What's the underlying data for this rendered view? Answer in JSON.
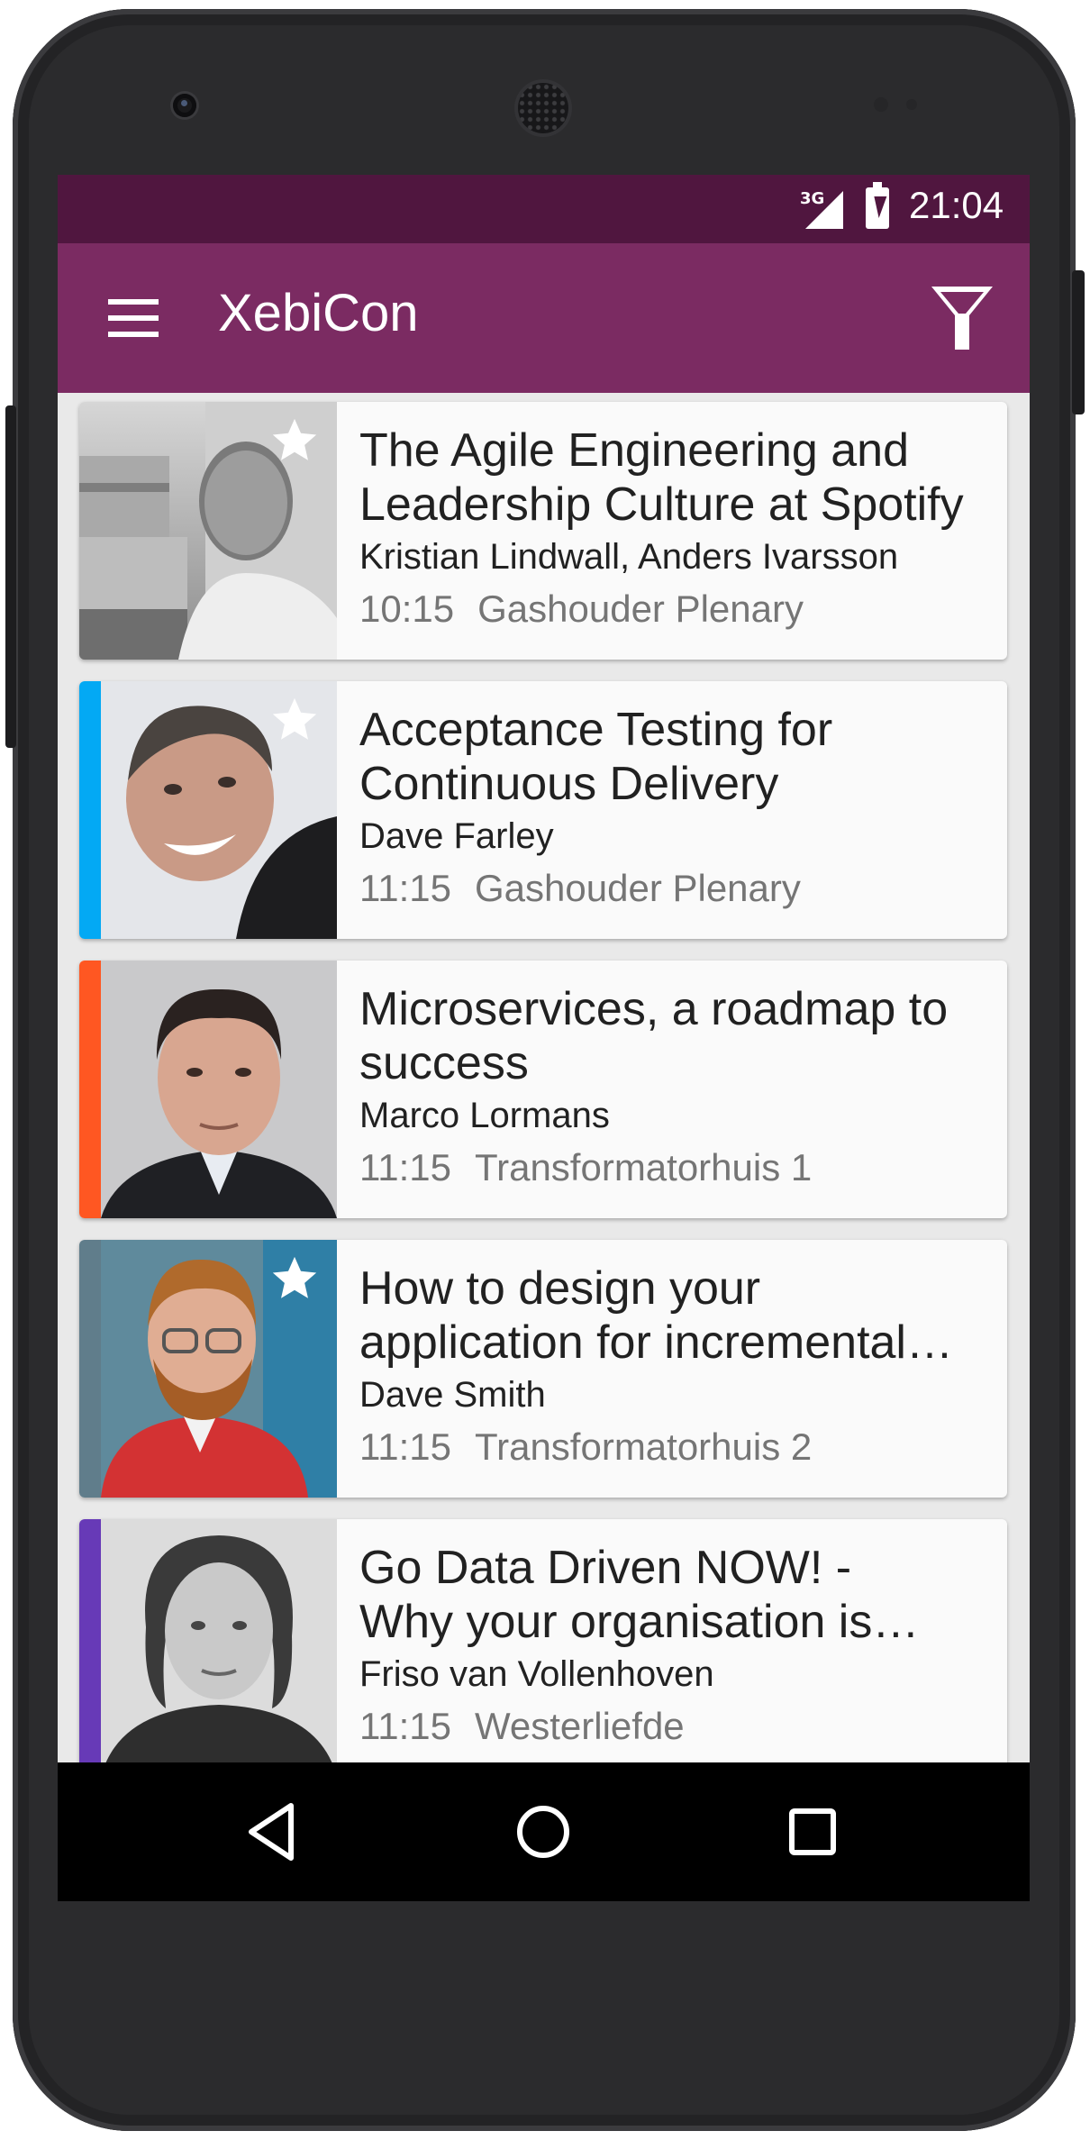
{
  "status_bar": {
    "network": "3G",
    "time": "21:04"
  },
  "app_bar": {
    "title": "XebiCon",
    "menu_icon": "hamburger-menu-icon",
    "filter_icon": "filter-funnel-icon"
  },
  "sessions": [
    {
      "title_lines": [
        "The Agile Engineering and",
        "Leadership Culture at Spotify"
      ],
      "speakers": "Kristian Lindwall, Anders Ivarsson",
      "time": "10:15",
      "location": "Gashouder Plenary",
      "favorite": true,
      "accent_color": "#9e9e9e"
    },
    {
      "title_lines": [
        "Acceptance Testing for",
        "Continuous Delivery"
      ],
      "speakers": "Dave Farley",
      "time": "11:15",
      "location": "Gashouder Plenary",
      "favorite": true,
      "accent_color": "#03a9f4"
    },
    {
      "title_lines": [
        "Microservices, a roadmap to",
        "success"
      ],
      "speakers": "Marco Lormans",
      "time": "11:15",
      "location": "Transformatorhuis 1",
      "favorite": false,
      "accent_color": "#ff5722"
    },
    {
      "title_lines": [
        "How to design your",
        "application for incremental…"
      ],
      "speakers": "Dave Smith",
      "time": "11:15",
      "location": "Transformatorhuis 2",
      "favorite": true,
      "accent_color": "#607d8b"
    },
    {
      "title_lines": [
        "Go Data Driven NOW! -",
        "Why your organisation is…"
      ],
      "speakers": "Friso van Vollenhoven",
      "time": "11:15",
      "location": "Westerliefde",
      "favorite": false,
      "accent_color": "#673ab7"
    }
  ],
  "nav_bar": {
    "back_icon": "back-triangle-icon",
    "home_icon": "home-circle-icon",
    "recents_icon": "recents-square-icon"
  },
  "colors": {
    "status_bar": "#50163f",
    "app_bar": "#7b2b62",
    "nav_bar": "#000000",
    "card_background": "#fafafa"
  }
}
